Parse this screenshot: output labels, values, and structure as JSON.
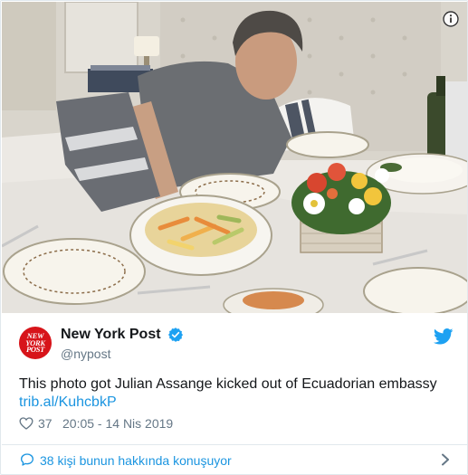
{
  "photo": {
    "alt": "",
    "info_icon": "info-icon"
  },
  "account": {
    "display_name": "New York Post",
    "handle": "@nypost",
    "avatar_lines": [
      "NEW",
      "YORK",
      "POST"
    ],
    "verified_icon": "verified-badge-icon",
    "platform_icon": "twitter-bird-icon"
  },
  "tweet": {
    "text": "This photo got Julian Assange kicked out of Ecuadorian embassy",
    "link": "trib.al/KuhcbkP",
    "likes": "37",
    "timestamp": "20:05 - 14 Nis 2019",
    "like_icon": "heart-icon"
  },
  "footer": {
    "conversation_label": "38 kişi bunun hakkında konuşuyor",
    "conversation_icon": "speech-bubble-icon",
    "chevron_icon": "chevron-right-icon"
  },
  "colors": {
    "link": "#1b95e0",
    "secondary_text": "#657786",
    "verified": "#1da1f2",
    "avatar_bg": "#d7141a",
    "divider": "#e1e8ed"
  }
}
